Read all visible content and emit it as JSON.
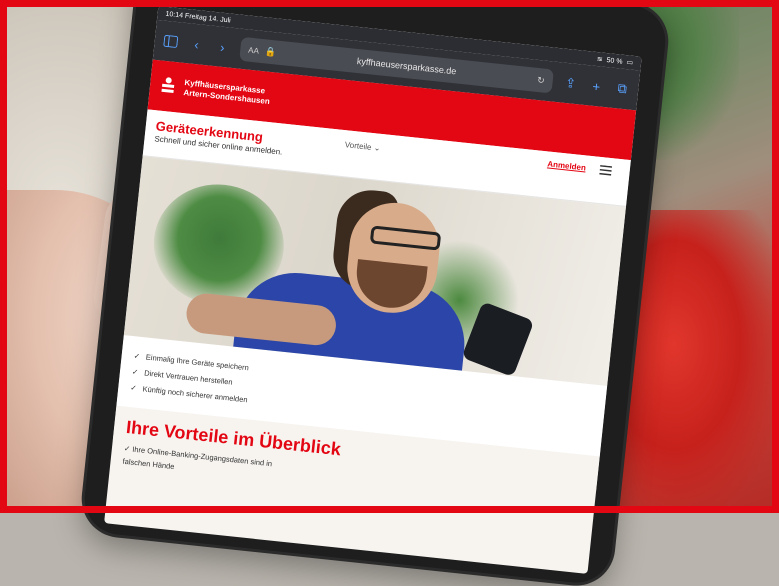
{
  "browser": {
    "time": "10:14",
    "date": "Freitag 14. Juli",
    "battery": "50 %",
    "url": "kyffhaeusersparkasse.de",
    "text_size_label": "AA",
    "accent_color": "#0a84ff"
  },
  "bank": {
    "name_line1": "Kyffhäusersparkasse",
    "name_line2": "Artern-Sondershausen",
    "brand_color": "#e30613"
  },
  "site": {
    "page_title": "Geräteerkennung",
    "page_subtitle": "Schnell und sicher online anmelden.",
    "nav_dropdown": "Vorteile",
    "login_link": "Anmelden"
  },
  "benefits": [
    "Einmalig Ihre Geräte speichern",
    "Direkt Vertrauen herstellen",
    "Künftig noch sicherer anmelden"
  ],
  "section": {
    "title": "Ihre Vorteile im Überblick",
    "item1": "Ihre Online-Banking-Zugangsdaten sind in",
    "item2": "falschen Hände"
  }
}
